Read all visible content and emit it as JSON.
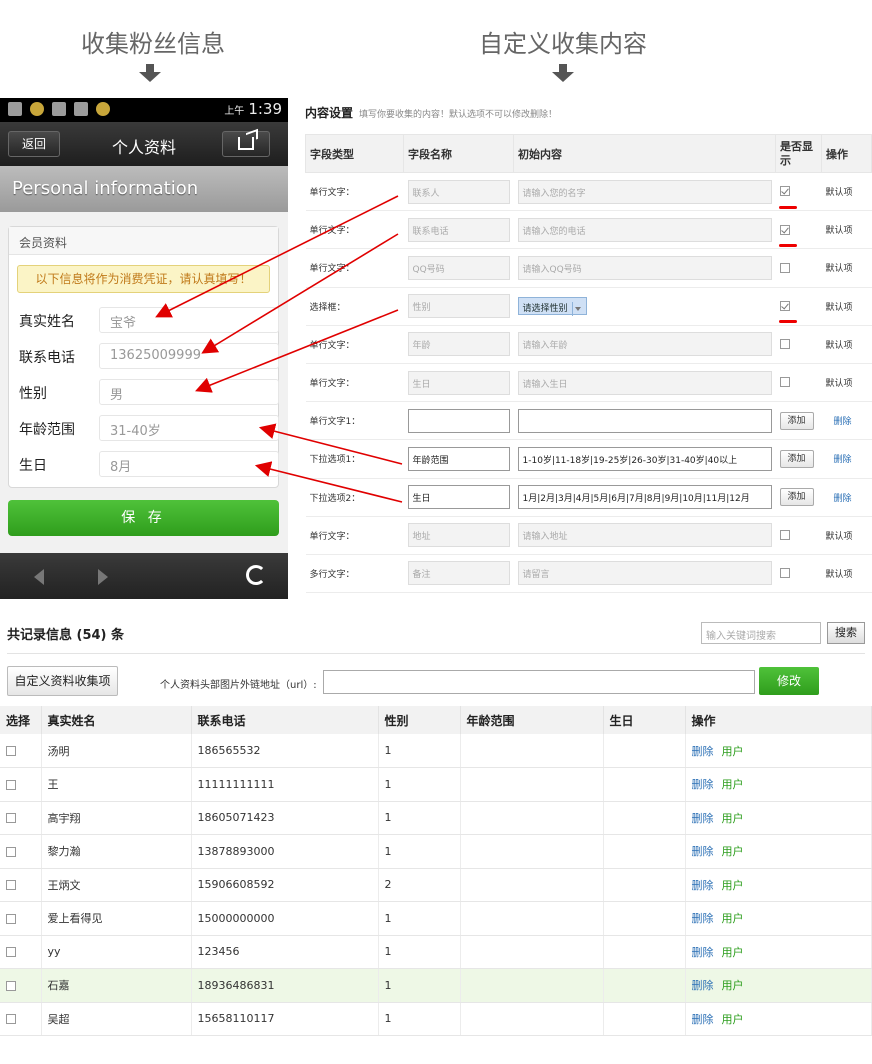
{
  "headers": {
    "left": "收集粉丝信息",
    "right": "自定义收集内容"
  },
  "phone": {
    "status_time": "1:39",
    "status_ampm": "上午",
    "back_label": "返回",
    "title": "个人资料",
    "banner": "Personal information",
    "card_title": "会员资料",
    "notice": "以下信息将作为消费凭证，请认真填写！",
    "fields": [
      {
        "label": "真实姓名",
        "value": "宝爷"
      },
      {
        "label": "联系电话",
        "value": "13625009999"
      },
      {
        "label": "性别",
        "value": "男"
      },
      {
        "label": "年龄范围",
        "value": "31-40岁"
      },
      {
        "label": "生日",
        "value": "8月"
      }
    ],
    "save_label": "保 存"
  },
  "settings": {
    "title": "内容设置",
    "hint": "填写你要收集的内容！默认选项不可以修改删除！",
    "columns": [
      "字段类型",
      "字段名称",
      "初始内容",
      "是否显示",
      "操作"
    ],
    "rows": [
      {
        "type": "单行文字：",
        "name": "联系人",
        "init": "请输入您的名字",
        "checked": true,
        "action": "默认项"
      },
      {
        "type": "单行文字：",
        "name": "联系电话",
        "init": "请输入您的电话",
        "checked": true,
        "action": "默认项"
      },
      {
        "type": "单行文字：",
        "name": "QQ号码",
        "init": "请输入QQ号码",
        "checked": false,
        "action": "默认项"
      },
      {
        "type": "选择框：",
        "name": "性别",
        "init": "请选择性别",
        "checked": true,
        "action": "默认项"
      },
      {
        "type": "单行文字：",
        "name": "年龄",
        "init": "请输入年龄",
        "checked": false,
        "action": "默认项"
      },
      {
        "type": "单行文字：",
        "name": "生日",
        "init": "请输入生日",
        "checked": false,
        "action": "默认项"
      },
      {
        "type": "单行文字1：",
        "name": "",
        "init": "",
        "add": "添加",
        "del": "删除"
      },
      {
        "type": "下拉选项1：",
        "name": "年龄范围",
        "init": "1-10岁|11-18岁|19-25岁|26-30岁|31-40岁|40以上",
        "add": "添加",
        "del": "删除"
      },
      {
        "type": "下拉选项2：",
        "name": "生日",
        "init": "1月|2月|3月|4月|5月|6月|7月|8月|9月|10月|11月|12月",
        "add": "添加",
        "del": "删除"
      },
      {
        "type": "单行文字：",
        "name": "地址",
        "init": "请输入地址",
        "checked": false,
        "action": "默认项"
      },
      {
        "type": "多行文字：",
        "name": "备注",
        "init": "请留言",
        "checked": false,
        "action": "默认项"
      }
    ]
  },
  "records": {
    "title": "共记录信息 (54) 条",
    "search_placeholder": "输入关键词搜索",
    "search_label": "搜索",
    "custom_button": "自定义资料收集项",
    "url_label": "个人资料头部图片外链地址（url）:",
    "modify_label": "修改",
    "columns": [
      "选择",
      "真实姓名",
      "联系电话",
      "性别",
      "年龄范围",
      "生日",
      "操作"
    ],
    "delete_label": "删除",
    "user_label": "用户",
    "rows": [
      {
        "name": "汤明",
        "phone": "186565532",
        "gender": "1"
      },
      {
        "name": "王",
        "phone": "11111111111",
        "gender": "1"
      },
      {
        "name": "高宇翔",
        "phone": "18605071423",
        "gender": "1"
      },
      {
        "name": "黎力瀚",
        "phone": "13878893000",
        "gender": "1"
      },
      {
        "name": "王炳文",
        "phone": "15906608592",
        "gender": "2"
      },
      {
        "name": "爱上看得见",
        "phone": "15000000000",
        "gender": "1"
      },
      {
        "name": "yy",
        "phone": "123456",
        "gender": "1"
      },
      {
        "name": "石嘉",
        "phone": "18936486831",
        "gender": "1"
      },
      {
        "name": "吴超",
        "phone": "15658110117",
        "gender": "1"
      }
    ]
  },
  "colors": {
    "accent_green": "#2f9d1c",
    "arrow_red": "#e00000",
    "link_blue": "#2a6fb5"
  }
}
